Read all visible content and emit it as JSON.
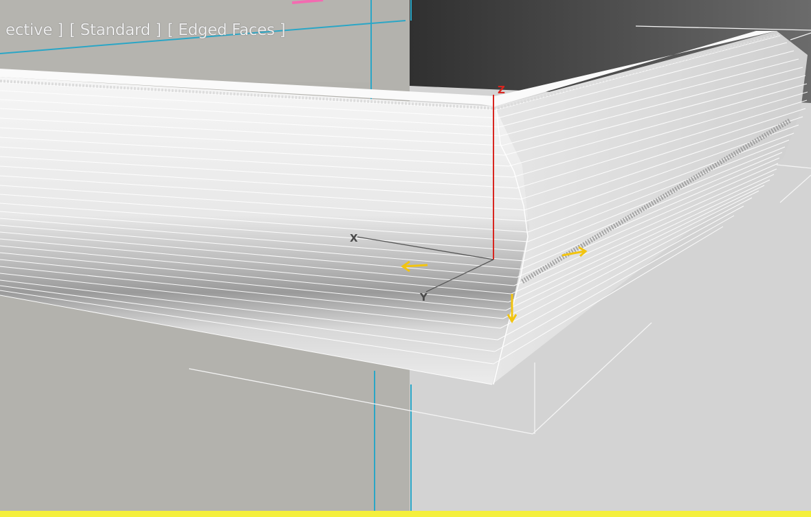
{
  "viewport": {
    "label_parts": [
      "ective ]",
      "[ Standard ]",
      "[ Edged Faces ]"
    ],
    "active_border_color": "#f4ef3c",
    "background_color": "#b3b2ad"
  },
  "gizmo": {
    "x_label": "X",
    "y_label": "Y",
    "z_label": "Z",
    "z_axis_color": "#d8251f",
    "handle_color": "#f2c40f"
  }
}
